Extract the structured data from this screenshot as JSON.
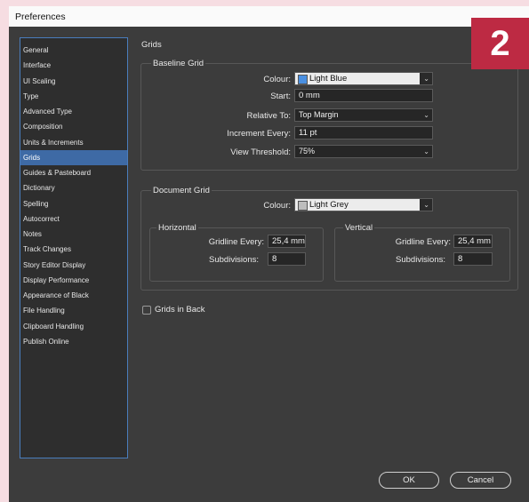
{
  "window": {
    "title": "Preferences"
  },
  "step_badge": "2",
  "sidebar": {
    "items": [
      {
        "label": "General"
      },
      {
        "label": "Interface"
      },
      {
        "label": "UI Scaling"
      },
      {
        "label": "Type"
      },
      {
        "label": "Advanced Type"
      },
      {
        "label": "Composition"
      },
      {
        "label": "Units & Increments"
      },
      {
        "label": "Grids",
        "active": true
      },
      {
        "label": "Guides & Pasteboard"
      },
      {
        "label": "Dictionary"
      },
      {
        "label": "Spelling"
      },
      {
        "label": "Autocorrect"
      },
      {
        "label": "Notes"
      },
      {
        "label": "Track Changes"
      },
      {
        "label": "Story Editor Display"
      },
      {
        "label": "Display Performance"
      },
      {
        "label": "Appearance of Black"
      },
      {
        "label": "File Handling"
      },
      {
        "label": "Clipboard Handling"
      },
      {
        "label": "Publish Online"
      }
    ]
  },
  "page_title": "Grids",
  "baseline": {
    "title": "Baseline Grid",
    "colour_label": "Colour:",
    "colour_value": "Light Blue",
    "colour_swatch": "#4a90e2",
    "start_label": "Start:",
    "start_value": "0 mm",
    "relative_label": "Relative To:",
    "relative_value": "Top Margin",
    "increment_label": "Increment Every:",
    "increment_value": "11 pt",
    "threshold_label": "View Threshold:",
    "threshold_value": "75%"
  },
  "document": {
    "title": "Document Grid",
    "colour_label": "Colour:",
    "colour_value": "Light Grey",
    "colour_swatch": "#bdbdbd",
    "horizontal": {
      "title": "Horizontal",
      "gridline_label": "Gridline Every:",
      "gridline_value": "25,4 mm",
      "subdivisions_label": "Subdivisions:",
      "subdivisions_value": "8"
    },
    "vertical": {
      "title": "Vertical",
      "gridline_label": "Gridline Every:",
      "gridline_value": "25,4 mm",
      "subdivisions_label": "Subdivisions:",
      "subdivisions_value": "8"
    }
  },
  "grids_in_back": {
    "label": "Grids in Back",
    "checked": false
  },
  "buttons": {
    "ok": "OK",
    "cancel": "Cancel"
  }
}
